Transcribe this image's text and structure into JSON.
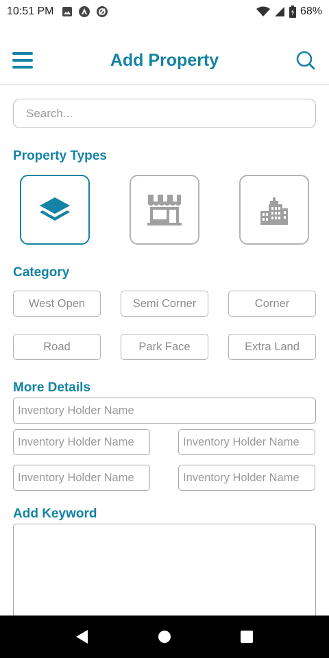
{
  "status_bar": {
    "time": "10:51 PM",
    "battery": "68%"
  },
  "header": {
    "title": "Add Property"
  },
  "search": {
    "placeholder": "Search..."
  },
  "property_types": {
    "heading": "Property Types",
    "items": [
      {
        "name": "layers-icon",
        "selected": true
      },
      {
        "name": "store-icon",
        "selected": false
      },
      {
        "name": "building-icon",
        "selected": false
      }
    ]
  },
  "category": {
    "heading": "Category",
    "chips": [
      "West Open",
      "Semi Corner",
      "Corner",
      "Road",
      "Park Face",
      "Extra Land"
    ]
  },
  "more_details": {
    "heading": "More Details",
    "placeholders": [
      "Inventory Holder Name",
      "Inventory Holder Name",
      "Inventory Holder Name",
      "Inventory Holder Name",
      "Inventory Holder Name"
    ]
  },
  "keyword": {
    "heading": "Add Keyword"
  },
  "colors": {
    "accent": "#1583a4",
    "border_gray": "#b3b3b3",
    "text_gray": "#8c8c8c"
  }
}
